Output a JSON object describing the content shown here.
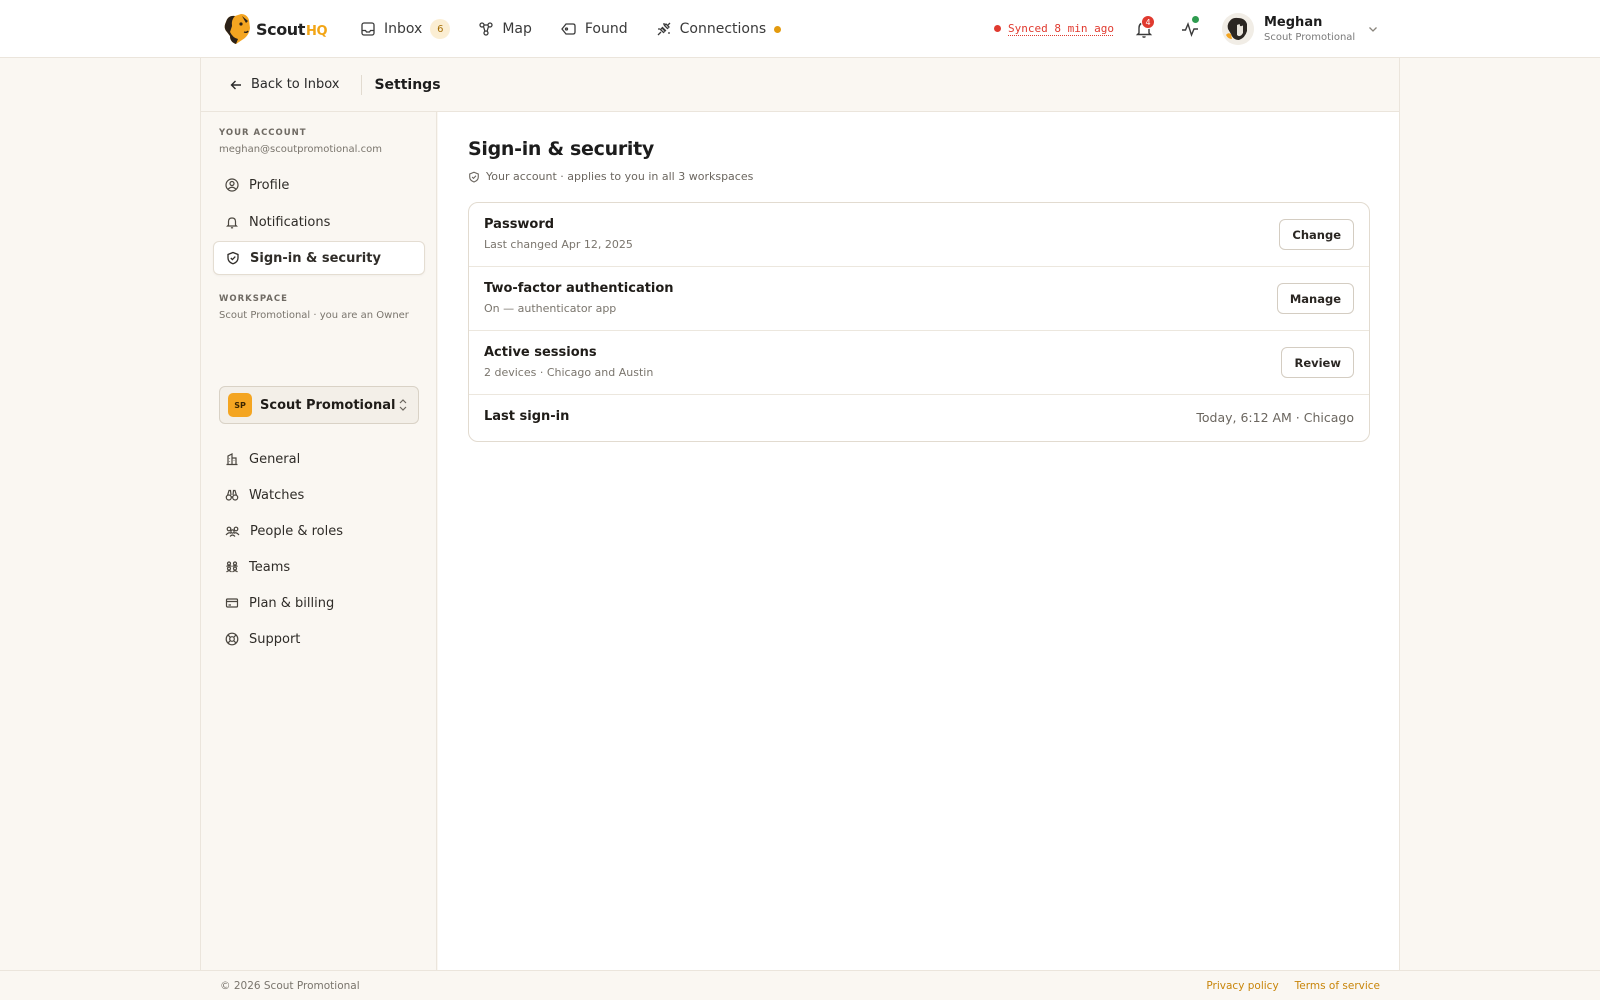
{
  "brand": {
    "name": "Scout",
    "suffix": "HQ"
  },
  "nav": {
    "items": [
      {
        "label": "Inbox",
        "badge": "6",
        "icon": "inbox-icon"
      },
      {
        "label": "Map",
        "icon": "map-nodes-icon"
      },
      {
        "label": "Found",
        "icon": "tag-icon"
      },
      {
        "label": "Connections",
        "icon": "plug-icon",
        "status_dot": "#e39a0e"
      }
    ]
  },
  "sync": {
    "text": "Synced 8 min ago",
    "color": "#e03a2f"
  },
  "notifications": {
    "count": "4"
  },
  "user": {
    "name": "Meghan",
    "org": "Scout Promotional"
  },
  "subheader": {
    "back_label": "Back to Inbox",
    "title": "Settings"
  },
  "sidebar": {
    "account_heading": "YOUR ACCOUNT",
    "account_email": "meghan@scoutpromotional.com",
    "account_items": [
      {
        "label": "Profile",
        "icon": "user-circle-icon"
      },
      {
        "label": "Notifications",
        "icon": "bell-icon"
      },
      {
        "label": "Sign-in & security",
        "icon": "shield-check-icon",
        "active": true
      }
    ],
    "workspace_heading": "WORKSPACE",
    "workspace_sub": "Scout Promotional · you are an Owner",
    "workspace_selector": {
      "initials": "SP",
      "name": "Scout Promotional"
    },
    "workspace_items": [
      {
        "label": "General",
        "icon": "building-icon"
      },
      {
        "label": "Watches",
        "icon": "binoculars-icon"
      },
      {
        "label": "People & roles",
        "icon": "people-icon"
      },
      {
        "label": "Teams",
        "icon": "team-icon"
      },
      {
        "label": "Plan & billing",
        "icon": "credit-card-icon"
      },
      {
        "label": "Support",
        "icon": "lifebuoy-icon"
      }
    ]
  },
  "main": {
    "title": "Sign-in & security",
    "subtitle": "Your account · applies to you in all 3 workspaces",
    "rows": [
      {
        "title": "Password",
        "sub": "Last changed Apr 12, 2025",
        "button": "Change"
      },
      {
        "title": "Two-factor authentication",
        "sub": "On — authenticator app",
        "button": "Manage"
      },
      {
        "title": "Active sessions",
        "sub": "2 devices · Chicago and Austin",
        "button": "Review"
      },
      {
        "title": "Last sign-in",
        "value": "Today, 6:12 AM · Chicago"
      }
    ]
  },
  "footer": {
    "copyright": "© 2026 Scout Promotional",
    "links": [
      "Privacy policy",
      "Terms of service"
    ]
  },
  "colors": {
    "accent": "#f2a516",
    "link": "#c8850a",
    "alert": "#e03a2f",
    "online": "#2e9b4f"
  }
}
